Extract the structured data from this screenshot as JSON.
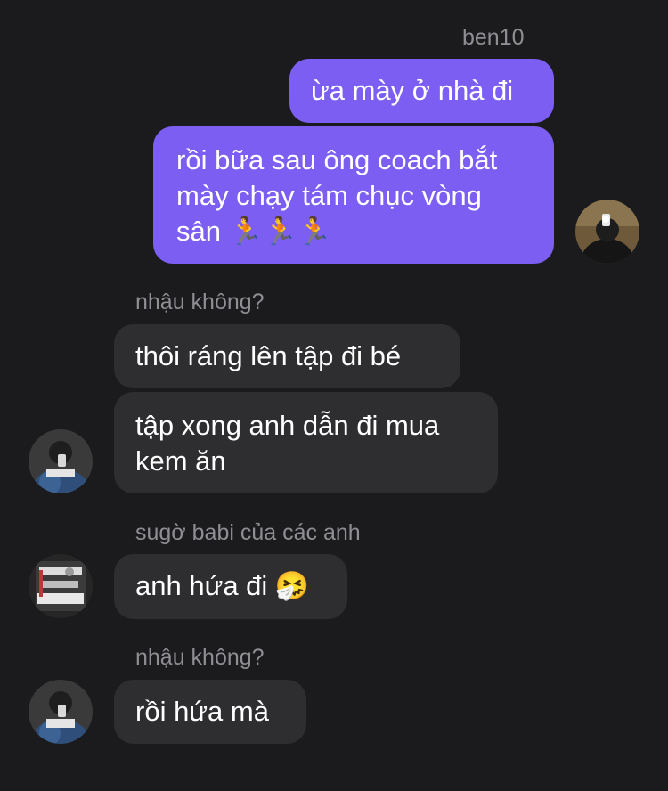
{
  "conversation": {
    "outgoing_sender": "ben10",
    "outgoing_messages": [
      {
        "lines": [
          "ừa mày ở nhà đi"
        ]
      },
      {
        "lines": [
          "rồi bữa sau ông coach bắt",
          "mày chạy tám chục vòng",
          "sân 🏃🏃🏃"
        ]
      }
    ],
    "incoming_groups": [
      {
        "sender": "nhậu không?",
        "messages": [
          {
            "lines": [
              "thôi ráng lên tập đi bé"
            ]
          },
          {
            "lines": [
              "tập xong anh dẫn đi mua",
              "kem ăn"
            ]
          }
        ]
      },
      {
        "sender": "sugờ babi của các anh",
        "messages": [
          {
            "lines": [
              "anh hứa đi 🤧"
            ]
          }
        ]
      },
      {
        "sender": "nhậu không?",
        "messages": [
          {
            "lines": [
              "rồi hứa mà"
            ]
          }
        ]
      }
    ]
  },
  "colors": {
    "background": "#1b1b1d",
    "outgoing_bubble": "#7c5ff2",
    "incoming_bubble": "#2e2e30",
    "sender_label": "#8e8e93",
    "text": "#ffffff"
  }
}
